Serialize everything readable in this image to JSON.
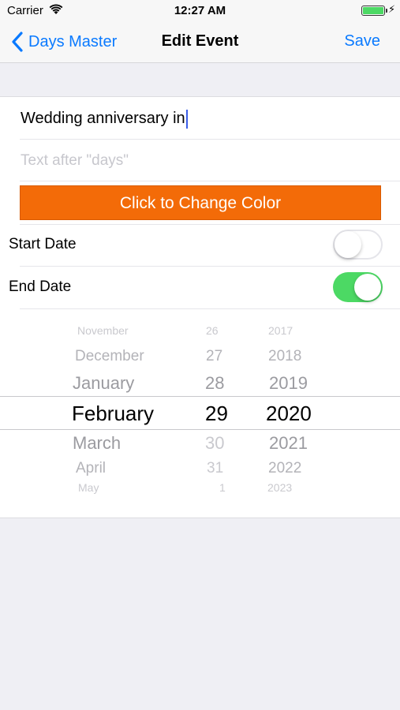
{
  "status_bar": {
    "carrier": "Carrier",
    "time": "12:27 AM",
    "battery_charging": "⚡",
    "battery_color": "#4cd964"
  },
  "nav": {
    "back_label": "Days Master",
    "title": "Edit Event",
    "save_label": "Save",
    "accent": "#0a7aff"
  },
  "form": {
    "title_value": "Wedding anniversary in",
    "suffix_placeholder": "Text after \"days\"",
    "color_button_label": "Click to Change Color",
    "color_button_bg": "#f36b08",
    "start_date_label": "Start Date",
    "start_date_on": false,
    "end_date_label": "End Date",
    "end_date_on": true,
    "switch_on_color": "#4cd964"
  },
  "picker": {
    "months": [
      "November",
      "December",
      "January",
      "February",
      "March",
      "April",
      "May"
    ],
    "days": [
      "26",
      "27",
      "28",
      "29",
      "30",
      "31",
      "1"
    ],
    "years": [
      "2017",
      "2018",
      "2019",
      "2020",
      "2021",
      "2022",
      "2023"
    ],
    "selected": {
      "month": "February",
      "day": "29",
      "year": "2020"
    }
  }
}
